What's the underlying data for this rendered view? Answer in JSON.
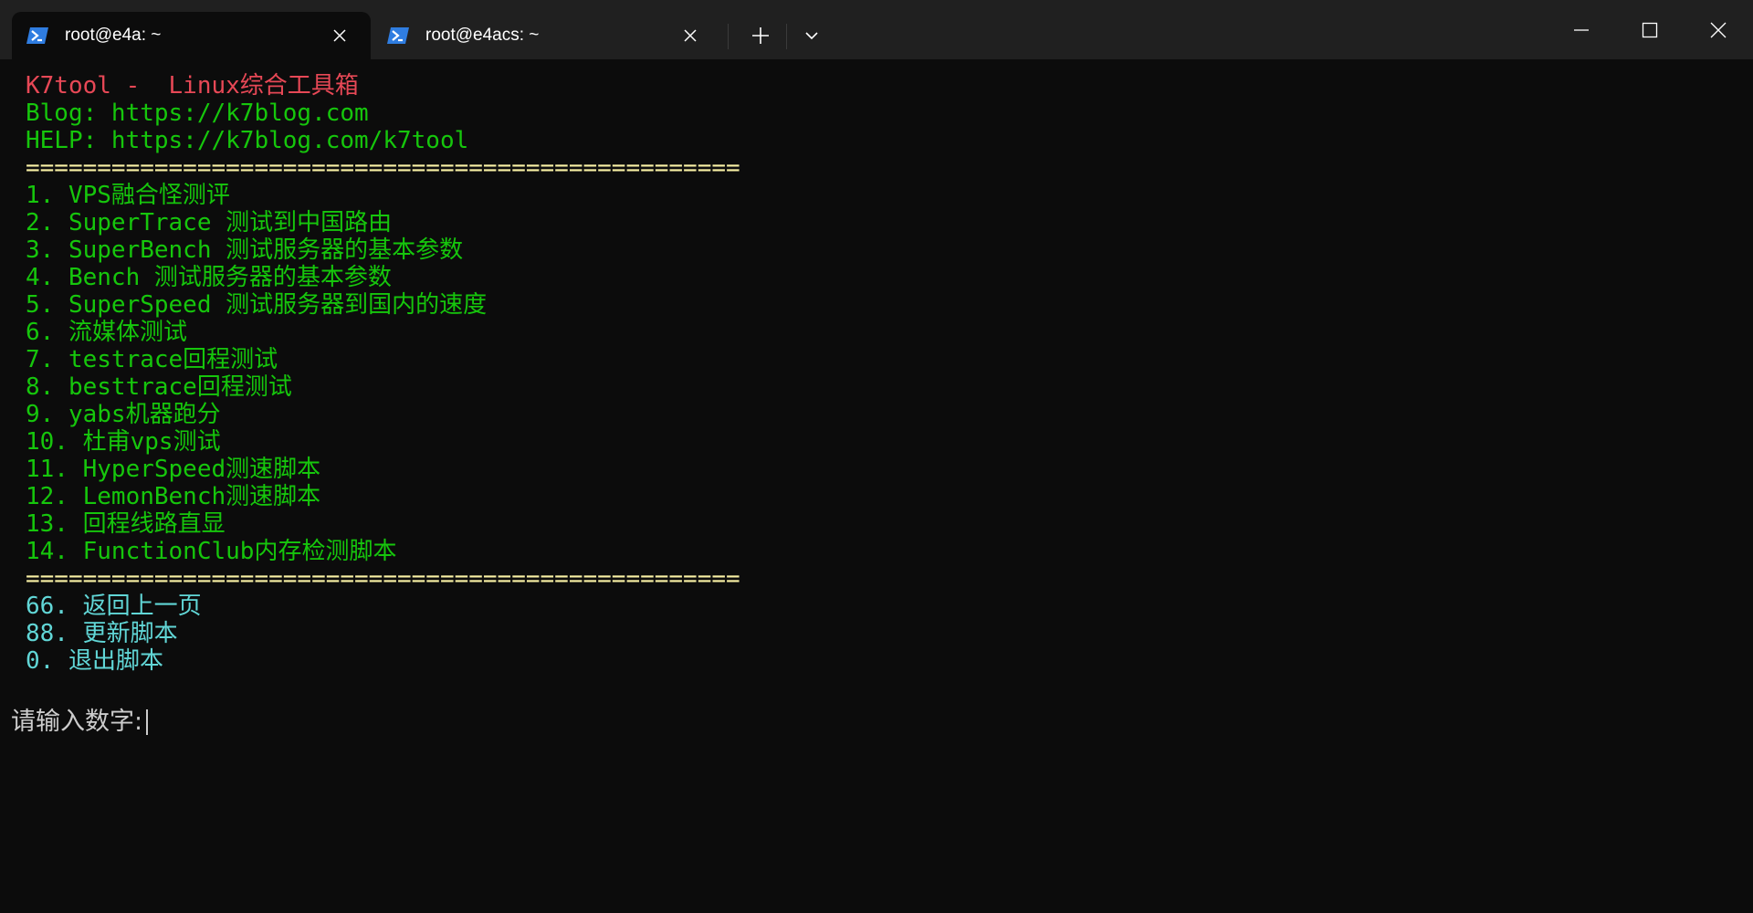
{
  "tabs": [
    {
      "icon": "powershell-icon",
      "label": "root@e4a: ~",
      "active": true
    },
    {
      "icon": "powershell-icon",
      "label": "root@e4acs: ~",
      "active": false
    }
  ],
  "colors": {
    "title": "#e74856",
    "menu": "#16c60c",
    "separator": "#f9f1a5",
    "nav": "#61d6d6",
    "prompt": "#cccccc",
    "background": "#0c0c0c",
    "titlebar": "#202020"
  },
  "terminal": {
    "header": {
      "title": "K7tool -  Linux综合工具箱",
      "blog": "Blog: https://k7blog.com",
      "help": "HELP: https://k7blog.com/k7tool"
    },
    "separator": "==================================================",
    "menu_items": [
      "1. VPS融合怪测评",
      "2. SuperTrace 测试到中国路由",
      "3. SuperBench 测试服务器的基本参数",
      "4. Bench 测试服务器的基本参数",
      "5. SuperSpeed 测试服务器到国内的速度",
      "6. 流媒体测试",
      "7. testrace回程测试",
      "8. besttrace回程测试",
      "9. yabs机器跑分",
      "10. 杜甫vps测试",
      "11. HyperSpeed测速脚本",
      "12. LemonBench测速脚本",
      "13. 回程线路直显",
      "14. FunctionClub内存检测脚本"
    ],
    "nav_items": [
      "66. 返回上一页",
      "88. 更新脚本",
      "0. 退出脚本"
    ],
    "prompt": "请输入数字:"
  }
}
